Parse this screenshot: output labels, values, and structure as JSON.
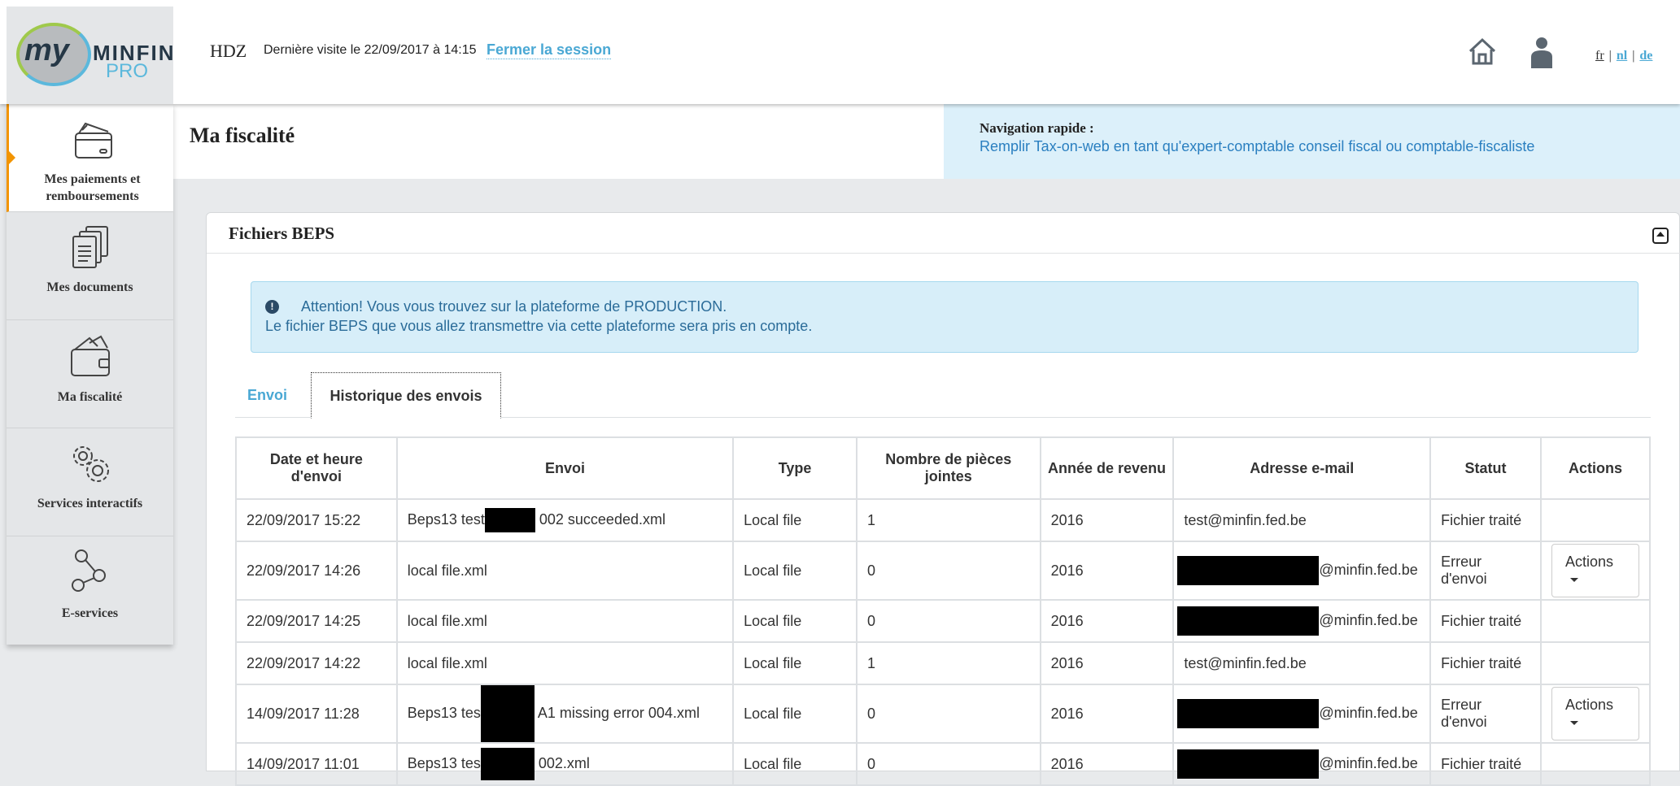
{
  "header": {
    "logo": {
      "my": "my",
      "minfin": "MINFIN",
      "pro": "PRO"
    },
    "user": "HDZ",
    "last_visit": "Dernière visite le 22/09/2017 à 14:15",
    "logout": "Fermer la session",
    "languages": [
      {
        "code": "fr",
        "current": true
      },
      {
        "code": "nl",
        "current": false
      },
      {
        "code": "de",
        "current": false
      }
    ]
  },
  "sidebar": {
    "items": [
      {
        "label": "Mes paiements et remboursements",
        "icon": "payment-card-icon",
        "active": true
      },
      {
        "label": "Mes documents",
        "icon": "documents-icon",
        "active": false
      },
      {
        "label": "Ma fiscalité",
        "icon": "wallet-icon",
        "active": false
      },
      {
        "label": "Services interactifs",
        "icon": "gears-icon",
        "active": false
      },
      {
        "label": "E-services",
        "icon": "share-nodes-icon",
        "active": false
      }
    ]
  },
  "page": {
    "title": "Ma fiscalité",
    "quick_nav_label": "Navigation rapide :",
    "quick_nav_link": "Remplir Tax-on-web en tant qu'expert-comptable conseil fiscal ou comptable-fiscaliste"
  },
  "panel": {
    "title": "Fichiers BEPS",
    "alert_line1": "Attention! Vous vous trouvez sur la plateforme de PRODUCTION.",
    "alert_line2": "Le fichier BEPS que vous allez transmettre via cette plateforme sera pris en compte.",
    "tabs": [
      {
        "label": "Envoi",
        "active": false
      },
      {
        "label": "Historique des envois",
        "active": true
      }
    ]
  },
  "table": {
    "headers": [
      "Date et heure d'envoi",
      "Envoi",
      "Type",
      "Nombre de pièces jointes",
      "Année de revenu",
      "Adresse e-mail",
      "Statut",
      "Actions"
    ],
    "rows": [
      {
        "date": "22/09/2017 15:22",
        "envoi_a": "Beps13 test",
        "envoi_b": "002 succeeded.xml",
        "type": "Local file",
        "pieces": "1",
        "annee": "2016",
        "email_pre": "",
        "email": "test@minfin.fed.be",
        "statut": "Fichier traité",
        "action": ""
      },
      {
        "date": "22/09/2017 14:26",
        "envoi_a": "local file.xml",
        "envoi_b": "",
        "type": "Local file",
        "pieces": "0",
        "annee": "2016",
        "email_pre": "redacted",
        "email": "@minfin.fed.be",
        "statut": "Erreur d'envoi",
        "action": "Actions"
      },
      {
        "date": "22/09/2017 14:25",
        "envoi_a": "local file.xml",
        "envoi_b": "",
        "type": "Local file",
        "pieces": "0",
        "annee": "2016",
        "email_pre": "redacted",
        "email": "@minfin.fed.be",
        "statut": "Fichier traité",
        "action": ""
      },
      {
        "date": "22/09/2017 14:22",
        "envoi_a": "local file.xml",
        "envoi_b": "",
        "type": "Local file",
        "pieces": "1",
        "annee": "2016",
        "email_pre": "",
        "email": "test@minfin.fed.be",
        "statut": "Fichier traité",
        "action": ""
      },
      {
        "date": "14/09/2017 11:28",
        "envoi_a": "Beps13 tes",
        "envoi_b": "A1 missing error 004.xml",
        "type": "Local file",
        "pieces": "0",
        "annee": "2016",
        "email_pre": "redacted",
        "email": "@minfin.fed.be",
        "statut": "Erreur d'envoi",
        "action": "Actions"
      },
      {
        "date": "14/09/2017 11:01",
        "envoi_a": "Beps13 tes",
        "envoi_b": "002.xml",
        "type": "Local file",
        "pieces": "0",
        "annee": "2016",
        "email_pre": "redacted",
        "email": "@minfin.fed.be",
        "statut": "Fichier traité",
        "action": ""
      }
    ]
  },
  "colors": {
    "accent": "#4aa8d4",
    "active_marker": "#f29400",
    "alert_bg": "#d7eef9"
  }
}
